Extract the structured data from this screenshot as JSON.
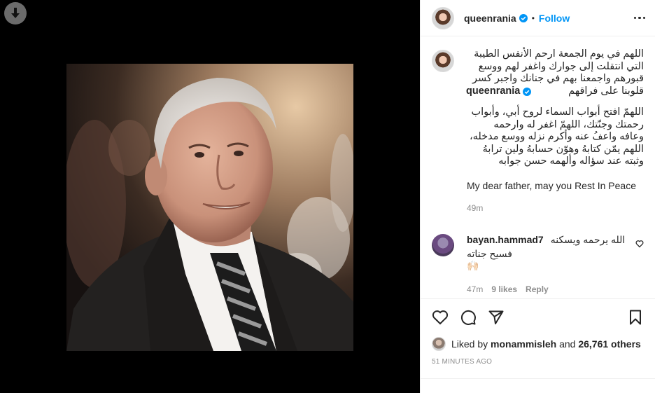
{
  "post": {
    "username": "queenrania",
    "follow_label": "Follow",
    "dot": "•",
    "caption": {
      "username": "queenrania",
      "arabic_para1": "اللهم في يوم الجمعة ارحم الأنفس الطيبة التي انتقلت إلى جوارك واغفر لهم ووسع قبورهم واجمعنا بهم في جنانك واجبر كسر قلوبنا على فراقهم",
      "arabic_para2": "اللهمّ افتح أبواب السماء لروح أبي، وأبواب رحمتك وجنّتك، اللهمّ اغفر له وارحمه وعافه واعفُ عنه وأكرم نزله ووسع مدخله، اللهم يمّن كتابهُ وهوّن حسابهُ ولين ترابهُ وثبته عند سؤاله وألهمه حسن جوابه",
      "english": "My dear father, may you Rest In Peace",
      "time": "49m"
    },
    "comment": {
      "username": "bayan.hammad7",
      "text_line1": "الله يرحمه ويسكنه",
      "text_line2": "فسيح جناته 🙌🏻",
      "time": "47m",
      "likes": "9 likes",
      "reply": "Reply"
    },
    "likes": {
      "prefix": "Liked by",
      "user": "monammisleh",
      "and": "and",
      "count": "26,761 others"
    },
    "posted": "51 MINUTES AGO"
  },
  "icons": {
    "download": "download-icon",
    "verified": "verified-badge-icon",
    "more": "more-options-icon",
    "like": "heart-icon",
    "comment": "comment-icon",
    "share": "share-icon",
    "save": "bookmark-icon"
  },
  "colors": {
    "accent": "#0095f6",
    "muted": "#8e8e8e",
    "text": "#262626"
  }
}
